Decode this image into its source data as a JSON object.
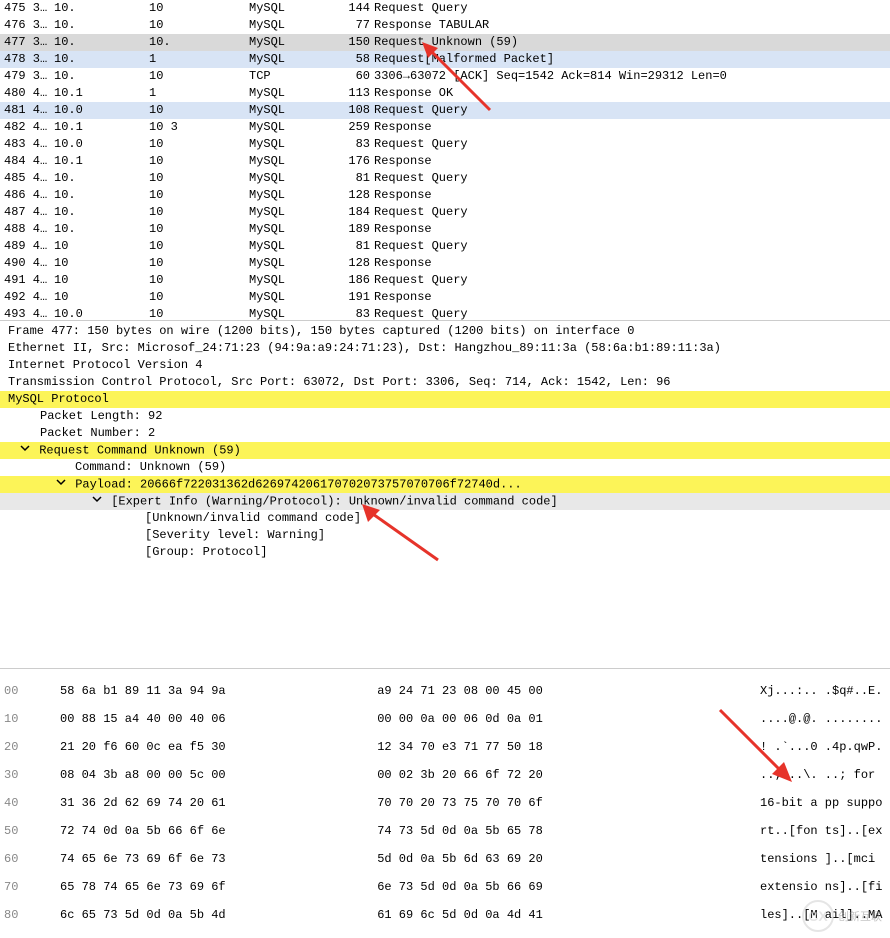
{
  "packets": [
    {
      "no": "475 3…",
      "src": "10.",
      "src2": "10",
      "proto": "MySQL",
      "len": "144",
      "info": "Request Query"
    },
    {
      "no": "476 3…",
      "src": "10.",
      "src2": "10",
      "proto": "MySQL",
      "len": "77",
      "info": "Response TABULAR"
    },
    {
      "no": "477 3…",
      "src": "10.",
      "src2": "10.",
      "proto": "MySQL",
      "len": "150",
      "info": "Request Unknown (59)",
      "sel": true
    },
    {
      "no": "478 3…",
      "src": "10.",
      "src2": "1",
      "proto": "MySQL",
      "len": "58",
      "info": "Request[Malformed Packet]",
      "blue": true
    },
    {
      "no": "479 3…",
      "src": "10.",
      "src2": "10",
      "proto": "TCP",
      "len": "60",
      "info": "3306→63072 [ACK] Seq=1542 Ack=814 Win=29312 Len=0"
    },
    {
      "no": "480 4…",
      "src": "10.1",
      "src2": "1",
      "proto": "MySQL",
      "len": "113",
      "info": "Response OK"
    },
    {
      "no": "481 4…",
      "src": "10.0",
      "src2": "10",
      "proto": "MySQL",
      "len": "108",
      "info": "Request Query",
      "blue": true
    },
    {
      "no": "482 4…",
      "src": "10.1",
      "src2": "10    3",
      "proto": "MySQL",
      "len": "259",
      "info": "Response"
    },
    {
      "no": "483 4…",
      "src": "10.0",
      "src2": "10",
      "proto": "MySQL",
      "len": "83",
      "info": "Request Query"
    },
    {
      "no": "484 4…",
      "src": "10.1",
      "src2": "10",
      "proto": "MySQL",
      "len": "176",
      "info": "Response"
    },
    {
      "no": "485 4…",
      "src": "10.",
      "src2": "10",
      "proto": "MySQL",
      "len": "81",
      "info": "Request Query"
    },
    {
      "no": "486 4…",
      "src": "10.",
      "src2": "10",
      "proto": "MySQL",
      "len": "128",
      "info": "Response"
    },
    {
      "no": "487 4…",
      "src": "10.",
      "src2": "10",
      "proto": "MySQL",
      "len": "184",
      "info": "Request Query"
    },
    {
      "no": "488 4…",
      "src": "10.",
      "src2": "10",
      "proto": "MySQL",
      "len": "189",
      "info": "Response"
    },
    {
      "no": "489 4…",
      "src": "10",
      "src2": "10",
      "proto": "MySQL",
      "len": "81",
      "info": "Request Query"
    },
    {
      "no": "490 4…",
      "src": "10",
      "src2": "10",
      "proto": "MySQL",
      "len": "128",
      "info": "Response"
    },
    {
      "no": "491 4…",
      "src": "10",
      "src2": "10",
      "proto": "MySQL",
      "len": "186",
      "info": "Request Query"
    },
    {
      "no": "492 4…",
      "src": "10",
      "src2": "10",
      "proto": "MySQL",
      "len": "191",
      "info": "Response"
    },
    {
      "no": "493 4…",
      "src": "10.0",
      "src2": "10",
      "proto": "MySQL",
      "len": "83",
      "info": "Request Query"
    }
  ],
  "details": {
    "frame": "Frame 477: 150 bytes on wire (1200 bits), 150 bytes captured (1200 bits) on interface 0",
    "eth": "Ethernet II, Src: Microsof_24:71:23 (94:9a:a9:24:71:23), Dst: Hangzhou_89:11:3a (58:6a:b1:89:11:3a)",
    "ip": "Internet Protocol Version 4",
    "tcp": "Transmission Control Protocol, Src Port: 63072, Dst Port: 3306, Seq: 714, Ack: 1542, Len: 96",
    "mysql": "MySQL Protocol",
    "pktlen": "Packet Length: 92",
    "pktnum": "Packet Number: 2",
    "reqcmd": "Request Command Unknown (59)",
    "cmd": "Command: Unknown (59)",
    "payload": "Payload: 20666f722031362d626974206170702073757070706f72740d...",
    "expert": "[Expert Info (Warning/Protocol): Unknown/invalid command code]",
    "expert_msg": "[Unknown/invalid command code]",
    "expert_sev": "[Severity level: Warning]",
    "expert_grp": "[Group: Protocol]"
  },
  "hex": [
    {
      "off": "00",
      "b1": "58 6a b1 89 11 3a 94 9a",
      "b2": " a9 24 71 23 08 00 45 00",
      "ascii": "Xj...:.. .$q#..E."
    },
    {
      "off": "10",
      "b1": "00 88 15 a4 40 00 40 06",
      "b2": " 00 00 0a 00 06 0d 0a 01",
      "ascii": "....@.@. ........"
    },
    {
      "off": "20",
      "b1": "21 20 f6 60 0c ea f5 30",
      "b2": " 12 34 70 e3 71 77 50 18",
      "ascii": "! .`...0 .4p.qwP."
    },
    {
      "off": "30",
      "b1": "08 04 3b a8 00 00 5c 00",
      "b2": " 00 02 3b 20 66 6f 72 20",
      "ascii": "..;...\\. ..; for "
    },
    {
      "off": "40",
      "b1": "31 36 2d 62 69 74 20 61",
      "b2": " 70 70 20 73 75 70 70 6f",
      "ascii": "16-bit a pp suppo"
    },
    {
      "off": "50",
      "b1": "72 74 0d 0a 5b 66 6f 6e",
      "b2": " 74 73 5d 0d 0a 5b 65 78",
      "ascii": "rt..[fon ts]..[ex"
    },
    {
      "off": "60",
      "b1": "74 65 6e 73 69 6f 6e 73",
      "b2": " 5d 0d 0a 5b 6d 63 69 20",
      "ascii": "tensions ]..[mci "
    },
    {
      "off": "70",
      "b1": "65 78 74 65 6e 73 69 6f",
      "b2": " 6e 73 5d 0d 0a 5b 66 69",
      "ascii": "extensio ns]..[fi"
    },
    {
      "off": "80",
      "b1": "6c 65 73 5d 0d 0a 5b 4d",
      "b2": " 61 69 6c 5d 0d 0a 4d 41",
      "ascii": "les]..[M ail]..MA"
    }
  ],
  "logo": {
    "brand": "创新互联"
  }
}
